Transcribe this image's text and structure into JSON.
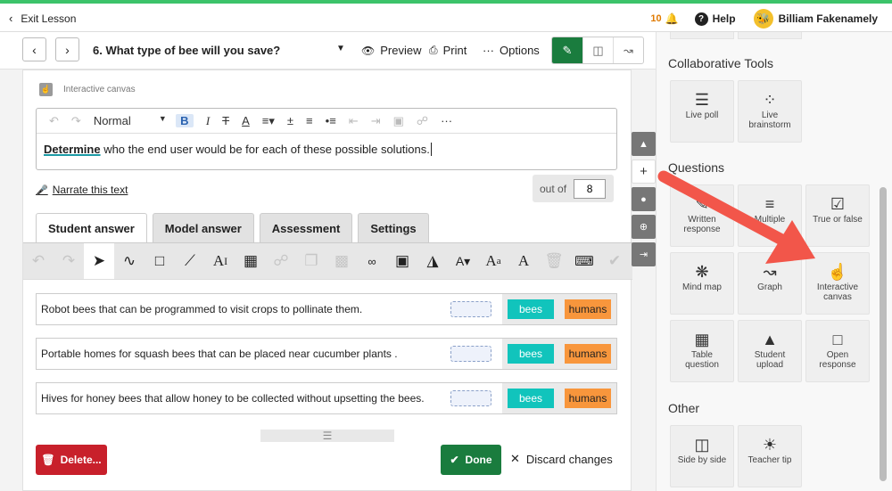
{
  "topbar": {
    "exit_label": "Exit Lesson",
    "notif_count": "10",
    "help_label": "Help",
    "user_name": "Billiam Fakenamely"
  },
  "header": {
    "lesson_title": "6. What type of bee will you save?",
    "preview_label": "Preview",
    "print_label": "Print",
    "options_label": "Options"
  },
  "card": {
    "type_label": "Interactive canvas",
    "editor": {
      "style_select": "Normal",
      "prompt_keyword": "Determine",
      "prompt_rest": " who the end user would be for each of these possible solutions."
    },
    "narrate_label": "Narrate this text",
    "out_of_label": "out of",
    "out_of_value": "8",
    "tabs": [
      "Student answer",
      "Model answer",
      "Assessment",
      "Settings"
    ],
    "rows": [
      {
        "text": "Robot bees that can be programmed to visit crops to pollinate them.",
        "chip1": "bees",
        "chip2": "humans"
      },
      {
        "text": "Portable homes for squash bees that can be placed near cucumber plants .",
        "chip1": "bees",
        "chip2": "humans"
      },
      {
        "text": "Hives for honey bees that allow honey to be collected without upsetting the bees.",
        "chip1": "bees",
        "chip2": "humans"
      }
    ],
    "delete_label": "Delete...",
    "done_label": "Done",
    "discard_label": "Discard changes"
  },
  "sidebar": {
    "collab_title": "Collaborative Tools",
    "collab": [
      {
        "label": "Live poll",
        "icon": "live-poll-icon"
      },
      {
        "label": "Live brainstorm",
        "icon": "brainstorm-icon"
      }
    ],
    "questions_title": "Questions",
    "questions": [
      {
        "label": "Written response",
        "icon": "pencil-icon"
      },
      {
        "label": "Multiple",
        "icon": "list-icon"
      },
      {
        "label": "True or false",
        "icon": "checklist-icon"
      },
      {
        "label": "Mind map",
        "icon": "mindmap-icon"
      },
      {
        "label": "Graph",
        "icon": "graph-icon"
      },
      {
        "label": "Interactive canvas",
        "icon": "canvas-icon"
      },
      {
        "label": "Table question",
        "icon": "table-icon"
      },
      {
        "label": "Student upload",
        "icon": "upload-icon"
      },
      {
        "label": "Open response",
        "icon": "open-response-icon"
      }
    ],
    "other_title": "Other",
    "other": [
      {
        "label": "Side by side",
        "icon": "columns-icon"
      },
      {
        "label": "Teacher tip",
        "icon": "lightbulb-icon"
      }
    ]
  },
  "colors": {
    "accent_green": "#1a7c3e",
    "arrow_red": "#f2564a",
    "chip_bees": "#11c4bc",
    "chip_humans": "#f8963c",
    "delete_red": "#c8202b"
  }
}
